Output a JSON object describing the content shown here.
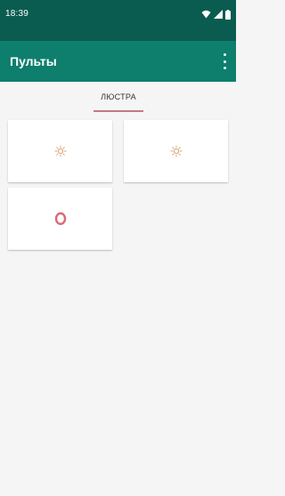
{
  "status_bar": {
    "time": "18:39",
    "icons": [
      "wifi-icon",
      "signal-icon",
      "battery-icon"
    ]
  },
  "app_bar": {
    "title": "Пульты",
    "menu_icon": "more-vert-icon"
  },
  "tabs": [
    {
      "label": "ЛЮСТРА",
      "selected": true
    }
  ],
  "buttons": [
    {
      "icon": "sun-icon"
    },
    {
      "icon": "sun-icon"
    },
    {
      "icon": "power-ring-icon"
    }
  ],
  "colors": {
    "status_bar": "#0a5c50",
    "app_bar": "#0e7e6d",
    "background": "#f5f5f5",
    "tab_indicator": "#c07b82",
    "sun_icon": "#d9a06a",
    "ring_icon": "#d96a78"
  }
}
